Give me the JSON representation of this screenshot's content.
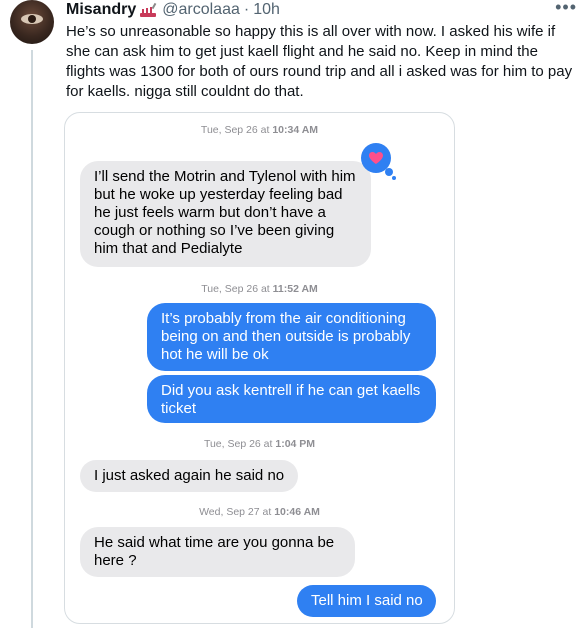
{
  "tweet": {
    "display_name": "Misandry",
    "handle": "@arcolaaa",
    "separator": "·",
    "time": "10h",
    "more_label": "•••",
    "text": "He’s so unreasonable so happy this is all over with now. I asked his wife if she can ask him to get just kaell flight and he said no. Keep in mind the flights was 1300 for both of ours round trip and all i asked was for him to pay for kaells. nigga still couldnt do that.",
    "badge_icon": "nail-polish-emoji-icon"
  },
  "conversation": {
    "groups": [
      {
        "stamp_date": "Tue, Sep 26 at",
        "stamp_time": "10:34 AM",
        "messages": [
          {
            "direction": "incoming",
            "text": "I’ll send the Motrin and Tylenol with him but he woke up yesterday feeling bad he just feels warm but don’t have a cough or nothing so I’ve been giving him that and Pedialyte",
            "tapback": "heart-icon"
          }
        ]
      },
      {
        "stamp_date": "Tue, Sep 26 at",
        "stamp_time": "11:52 AM",
        "messages": [
          {
            "direction": "outgoing",
            "text": "It’s probably from the air conditioning being on and then outside is probably hot he will be ok"
          },
          {
            "direction": "outgoing",
            "text": "Did you ask kentrell if he can get kaells ticket"
          }
        ]
      },
      {
        "stamp_date": "Tue, Sep 26 at",
        "stamp_time": "1:04 PM",
        "messages": [
          {
            "direction": "incoming",
            "text": "I just asked again he said no"
          }
        ]
      },
      {
        "stamp_date": "Wed, Sep 27 at",
        "stamp_time": "10:46 AM",
        "messages": [
          {
            "direction": "incoming",
            "text": "He said what time are you gonna be here ?"
          }
        ]
      },
      {
        "stamp_date": "",
        "stamp_time": "",
        "messages": [
          {
            "direction": "outgoing",
            "text": "Tell him I said no"
          }
        ]
      }
    ]
  },
  "colors": {
    "incoming_bubble": "#e9e9eb",
    "outgoing_bubble": "#2f80f2",
    "heart": "#ff4f8b"
  }
}
